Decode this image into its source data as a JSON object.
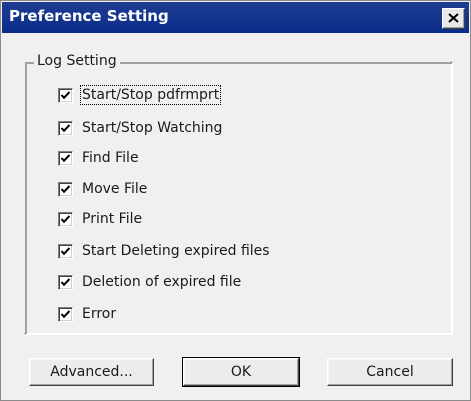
{
  "window": {
    "title": "Preference Setting",
    "close_icon": "close-icon"
  },
  "log_group": {
    "legend": "Log Setting",
    "items": [
      {
        "label": "Start/Stop pdfrmprt",
        "checked": true,
        "focused": true
      },
      {
        "label": "Start/Stop Watching",
        "checked": true
      },
      {
        "label": "Find File",
        "checked": true
      },
      {
        "label": "Move File",
        "checked": true
      },
      {
        "label": "Print File",
        "checked": true
      },
      {
        "label": "Start Deleting expired files",
        "checked": true
      },
      {
        "label": "Deletion of expired file",
        "checked": true
      },
      {
        "label": "Error",
        "checked": true
      }
    ]
  },
  "buttons": {
    "advanced_label": "Advanced...",
    "ok_label": "OK",
    "cancel_label": "Cancel"
  },
  "colors": {
    "titlebar": "#0b2c8a",
    "title_text": "#ffffff",
    "dialog_bg": "#f0f0f0"
  }
}
